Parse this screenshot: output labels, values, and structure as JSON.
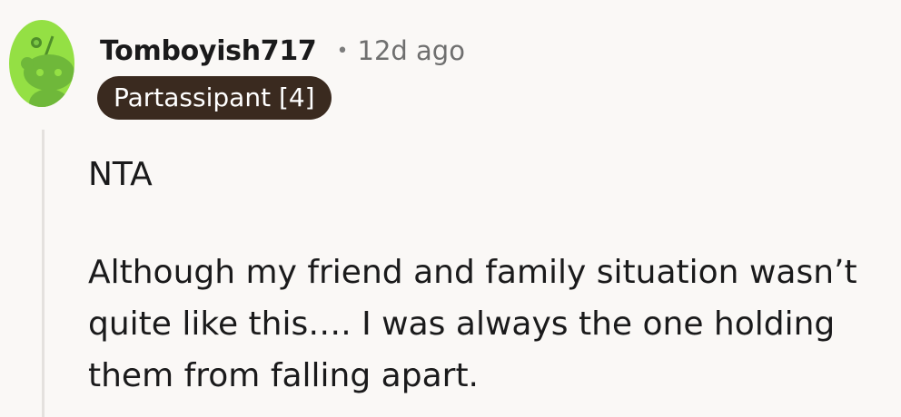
{
  "comment": {
    "author": "Tomboyish717",
    "separator": "•",
    "time_ago": "12d ago",
    "flair": "Partassipant [4]",
    "paragraphs": [
      "NTA",
      "Although my friend and family situation wasn’t quite like this…. I was always the one holding them from falling apart."
    ]
  },
  "avatar": {
    "icon": "reddit-snoo-icon",
    "background_color": "#94e044",
    "figure_color": "#6fb83a"
  },
  "colors": {
    "page_background": "#faf8f6",
    "flair_background": "#3a2a1f",
    "thread_line": "#e4e1de"
  }
}
